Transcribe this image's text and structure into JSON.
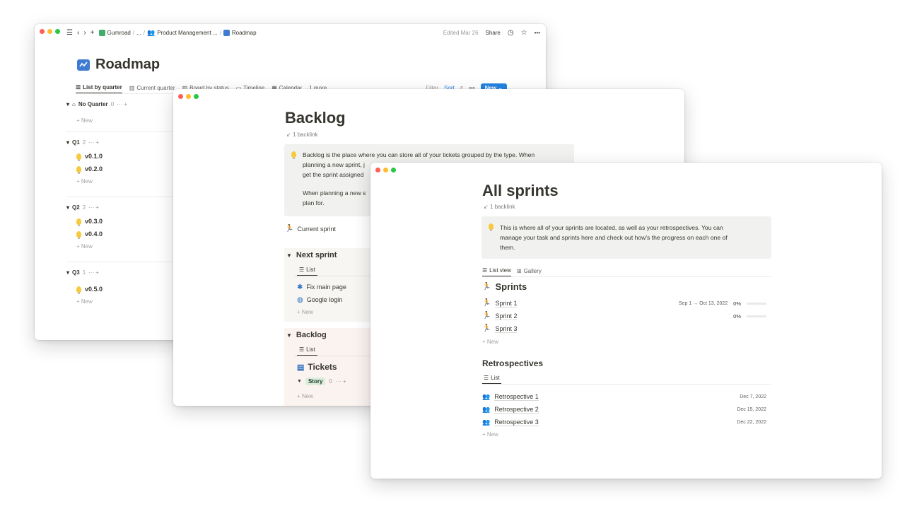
{
  "colors": {
    "red": "#ff5f57",
    "yellow": "#febc2e",
    "green": "#28c840",
    "accent": "#2383e2"
  },
  "roadmap": {
    "breadcrumb": [
      "Gumroad",
      "...",
      "Product Management ...",
      "Roadmap"
    ],
    "edited": "Edited Mar 26",
    "share": "Share",
    "title": "Roadmap",
    "views": [
      "List by quarter",
      "Current quarter",
      "Board by status",
      "Timeline",
      "Calendar",
      "1 more..."
    ],
    "filter": "Filter",
    "sort": "Sort",
    "new_button": "New",
    "groups": [
      {
        "name": "No Quarter",
        "count": "0",
        "items": []
      },
      {
        "name": "Q1",
        "count": "2",
        "items": [
          "v0.1.0",
          "v0.2.0"
        ]
      },
      {
        "name": "Q2",
        "count": "2",
        "items": [
          "v0.3.0",
          "v0.4.0"
        ]
      },
      {
        "name": "Q3",
        "count": "1",
        "items": [
          "v0.5.0"
        ]
      }
    ],
    "new_label": "New"
  },
  "backlog": {
    "title": "Backlog",
    "backlink": "1 backlink",
    "callout_lines": [
      "Backlog is the place where you can store all of your tickets grouped by the type. When",
      "planning a new sprint, j",
      "get the sprint assigned",
      "When planning a new s",
      "plan for."
    ],
    "current_sprint": "Current sprint",
    "next_sprint": {
      "title": "Next sprint",
      "tab": "List",
      "items": [
        "Fix main page",
        "Google login"
      ],
      "new_label": "New"
    },
    "backlog_section": {
      "title": "Backlog",
      "tab": "List",
      "tickets": "Tickets",
      "story": "Story",
      "story_count": "0",
      "new_label": "New"
    }
  },
  "sprints": {
    "title": "All sprints",
    "backlink": "1 backlink",
    "callout_lines": [
      "This is where all of your sprints are located, as well as your retrospectives. You can",
      "manage your task and sprints here and check out how's the progress on each one of",
      "them."
    ],
    "views": [
      "List view",
      "Gallery"
    ],
    "sprints_heading": "Sprints",
    "sprint_rows": [
      {
        "name": "Sprint 1",
        "dates": "Sep 1 → Oct 13, 2022",
        "progress": "0%"
      },
      {
        "name": "Sprint 2",
        "dates": "",
        "progress": "0%"
      },
      {
        "name": "Sprint 3",
        "dates": "",
        "progress": ""
      }
    ],
    "new_label": "New",
    "retro_heading": "Retrospectives",
    "retro_tab": "List",
    "retro_rows": [
      {
        "name": "Retrospective 1",
        "date": "Dec 7, 2022"
      },
      {
        "name": "Retrospective 2",
        "date": "Dec 15, 2022"
      },
      {
        "name": "Retrospective 3",
        "date": "Dec 22, 2022"
      }
    ]
  }
}
